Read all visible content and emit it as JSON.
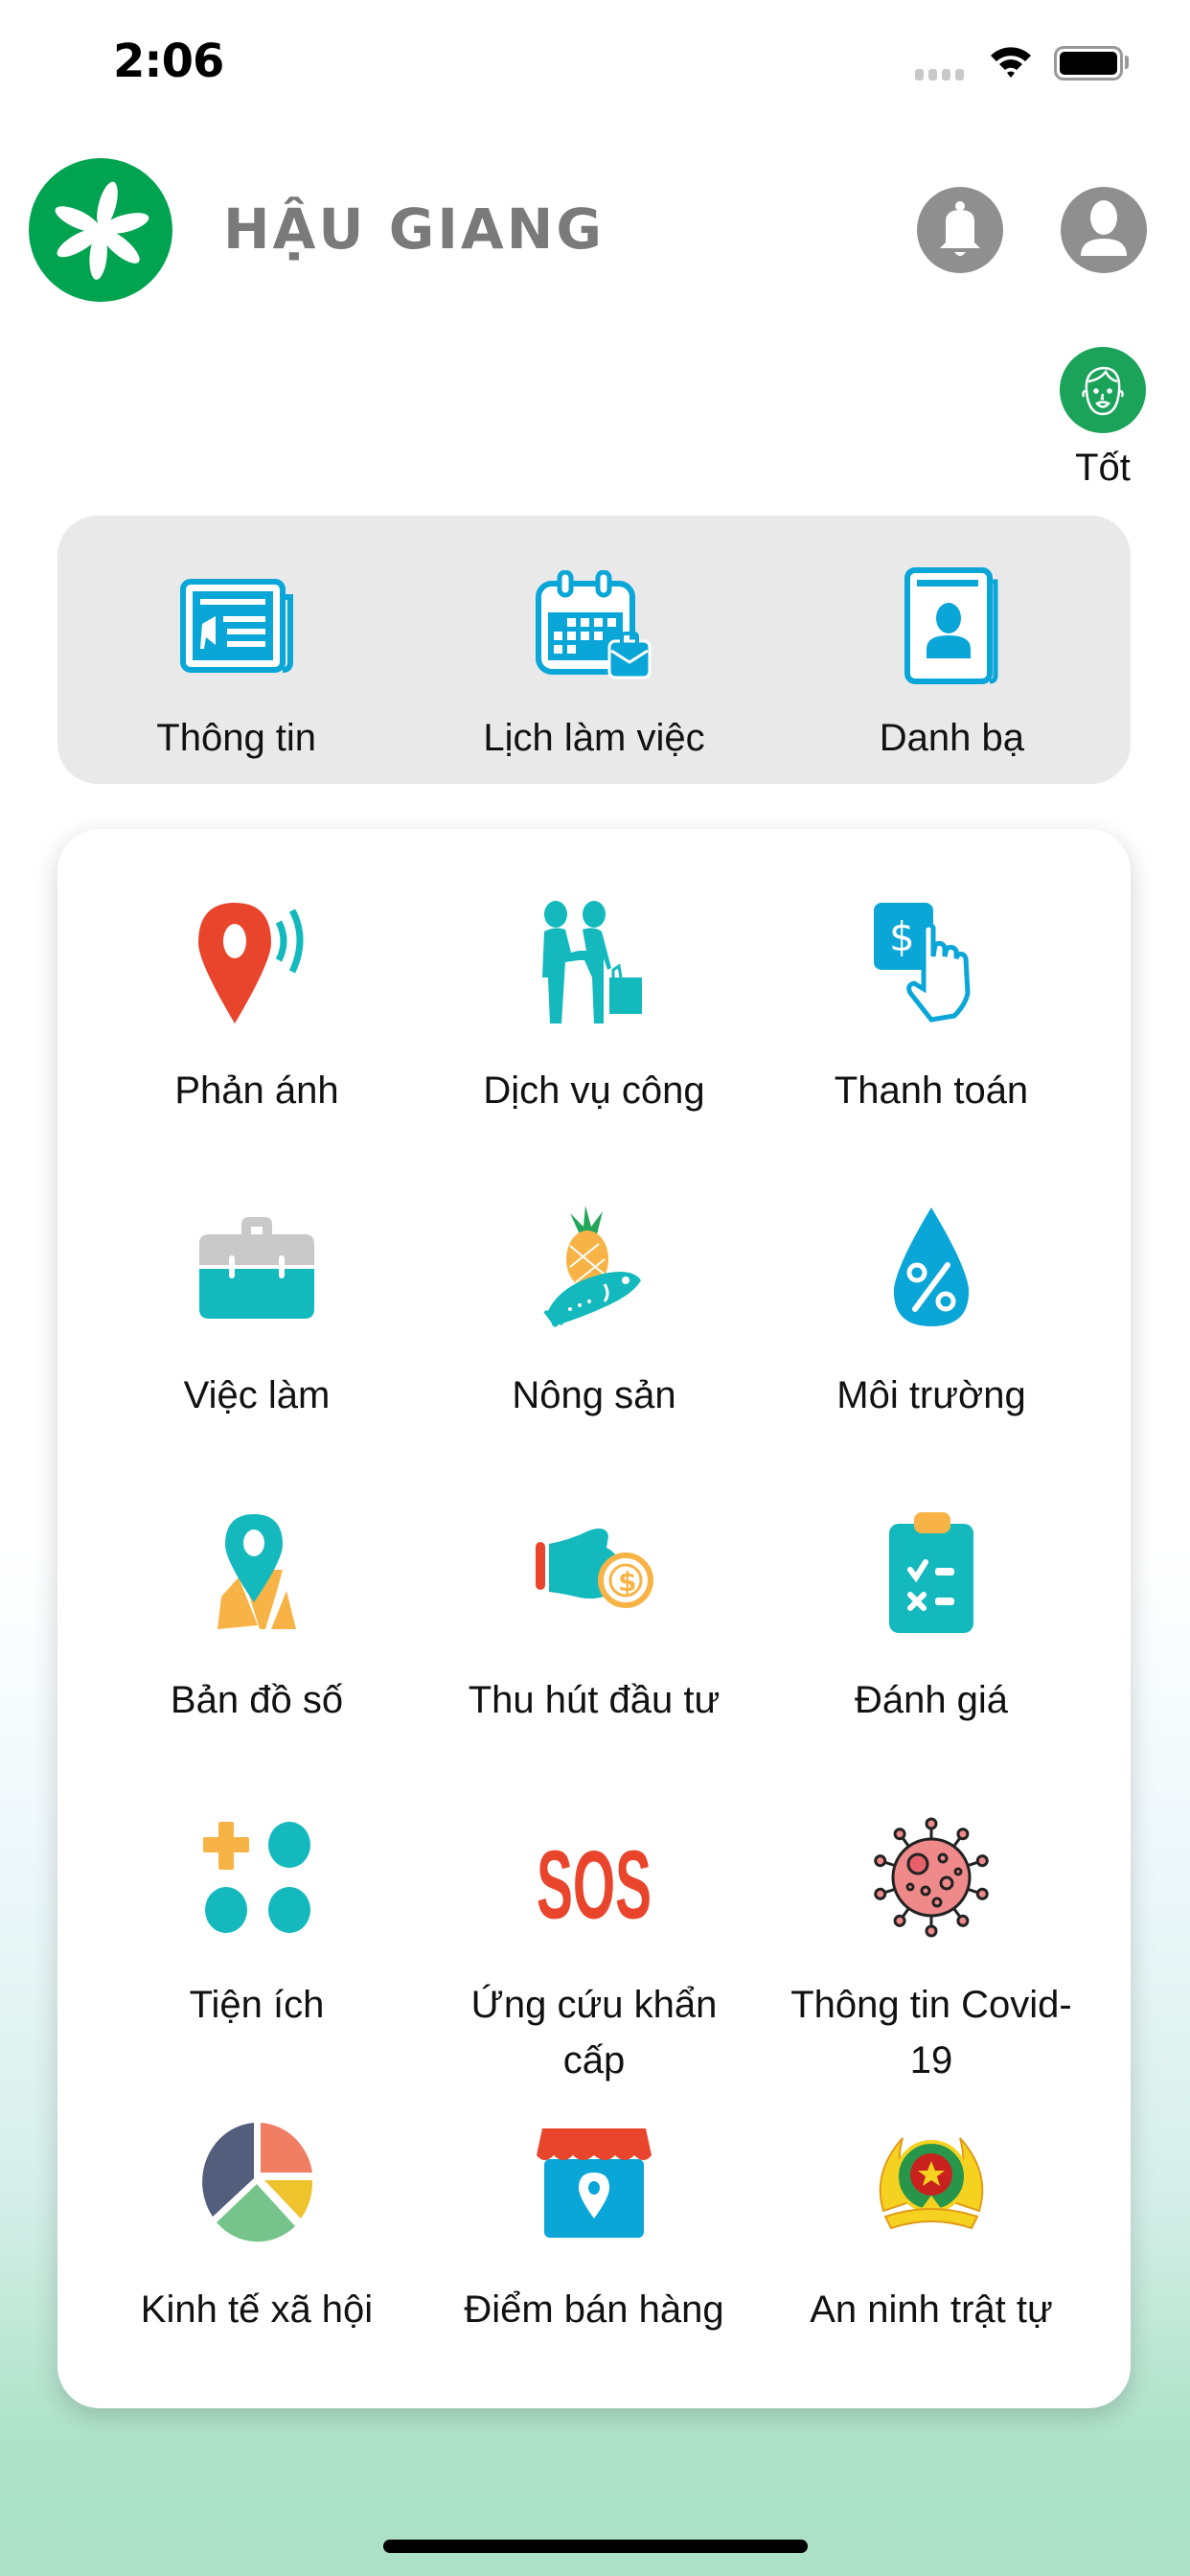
{
  "status_bar": {
    "time": "2:06",
    "icons": [
      "cellular-signal-icon",
      "wifi-icon",
      "battery-icon"
    ]
  },
  "header": {
    "title": "HẬU GIANG",
    "logo_icon": "flower-logo-icon",
    "notification_icon": "bell-icon",
    "profile_icon": "user-icon"
  },
  "mood": {
    "icon": "smiling-face-icon",
    "label": "Tốt"
  },
  "quick_actions": [
    {
      "label": "Thông tin",
      "icon": "newspaper-icon"
    },
    {
      "label": "Lịch làm việc",
      "icon": "calendar-briefcase-icon"
    },
    {
      "label": "Danh bạ",
      "icon": "contact-book-icon"
    }
  ],
  "services": [
    {
      "label": "Phản ánh",
      "icon": "location-broadcast-icon"
    },
    {
      "label": "Dịch vụ công",
      "icon": "handshake-icon"
    },
    {
      "label": "Thanh toán",
      "icon": "tap-payment-icon"
    },
    {
      "label": "Việc làm",
      "icon": "briefcase-icon"
    },
    {
      "label": "Nông sản",
      "icon": "pineapple-fish-icon"
    },
    {
      "label": "Môi trường",
      "icon": "water-drop-percent-icon"
    },
    {
      "label": "Bản đồ số",
      "icon": "map-pin-icon"
    },
    {
      "label": "Thu hút đầu tư",
      "icon": "hand-coin-icon"
    },
    {
      "label": "Đánh giá",
      "icon": "checklist-clipboard-icon"
    },
    {
      "label": "Tiện ích",
      "icon": "utilities-grid-icon"
    },
    {
      "label": "Ứng cứu khẩn cấp",
      "icon": "sos-icon"
    },
    {
      "label": "Thông tin Covid-19",
      "icon": "virus-icon"
    },
    {
      "label": "Kinh tế xã hội",
      "icon": "pie-chart-icon"
    },
    {
      "label": "Điểm bán hàng",
      "icon": "shop-location-icon"
    },
    {
      "label": "An ninh trật tự",
      "icon": "police-emblem-icon"
    }
  ],
  "colors": {
    "brand_green": "#00a350",
    "icon_blue": "#0aa6d8",
    "teal": "#13b9bd",
    "orange": "#f7b345",
    "red": "#e8452c",
    "grey_icon": "#8f8f8f"
  }
}
